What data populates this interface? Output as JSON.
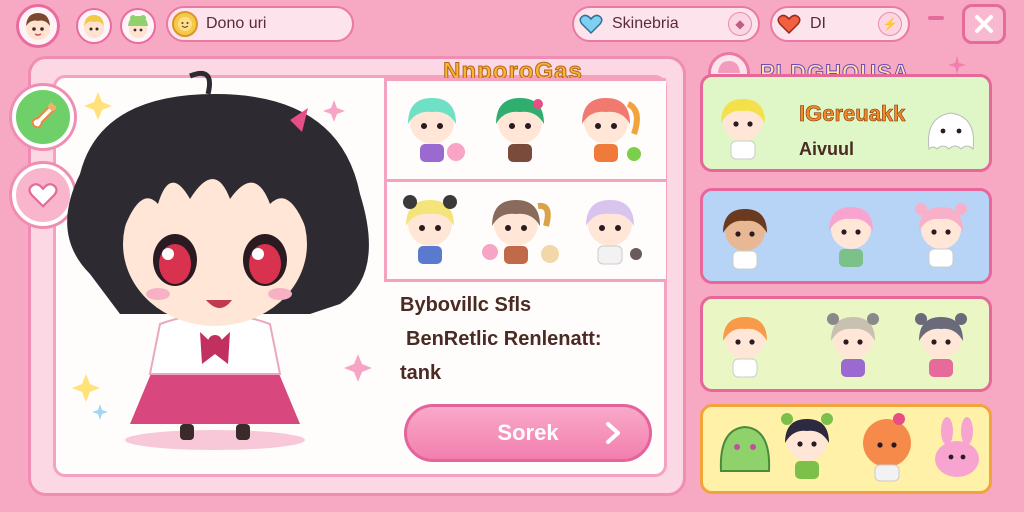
{
  "topbar": {
    "profile_chip_label": "Dono uri",
    "search_chip_label": "Skinebria",
    "second_chip_label": "DI"
  },
  "main": {
    "gallery_title": "NnporoGas",
    "description_line1": "Bybovillc Sfls",
    "description_line2": "BenRetlic Renlenatt:",
    "description_line3": "tank",
    "select_button_label": "Sorek"
  },
  "right": {
    "panel_title": "PLDGHOUSA",
    "card1_label_a": "IGereuakk",
    "card1_label_b": "Aivuul"
  },
  "colors": {
    "background": "#f7a9c4",
    "accent_pink": "#e96c9e",
    "button_pink": "#f27fae",
    "card_green": "#dff6c6",
    "card_blue": "#b7d4f7",
    "card_lime": "#eaf7c5",
    "card_yellow": "#fff1a8"
  },
  "icons": {
    "avatars_top": [
      "avatar-brown-hair",
      "avatar-blonde",
      "avatar-frog-hat"
    ],
    "side_buttons": [
      "edit-brush-icon",
      "heart-icon"
    ],
    "chips": [
      "heart-icon",
      "heart-icon"
    ],
    "window_controls": [
      "minimize-icon",
      "close-icon"
    ]
  }
}
